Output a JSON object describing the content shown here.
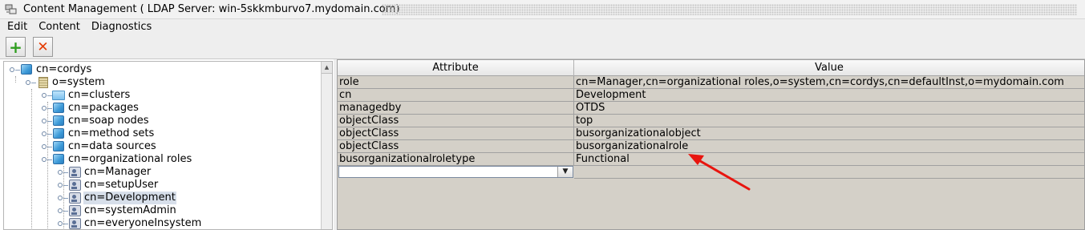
{
  "window": {
    "title": "Content Management ( LDAP Server: win-5skkmburvo7.mydomain.com)"
  },
  "menu": {
    "items": [
      {
        "label": "Edit"
      },
      {
        "label": "Content"
      },
      {
        "label": "Diagnostics"
      }
    ]
  },
  "toolbar": {
    "add_label": "+",
    "delete_label": "✕"
  },
  "tree": {
    "nodes": [
      {
        "label": "cn=cordys",
        "icon": "cube-icon",
        "level": 0
      },
      {
        "label": "o=system",
        "icon": "building-icon",
        "level": 1
      },
      {
        "label": "cn=clusters",
        "icon": "folder-icon",
        "level": 2
      },
      {
        "label": "cn=packages",
        "icon": "cube-icon",
        "level": 2
      },
      {
        "label": "cn=soap nodes",
        "icon": "cube-icon",
        "level": 2
      },
      {
        "label": "cn=method sets",
        "icon": "cube-icon",
        "level": 2
      },
      {
        "label": "cn=data sources",
        "icon": "cube-icon",
        "level": 2
      },
      {
        "label": "cn=organizational roles",
        "icon": "cube-icon",
        "level": 2
      },
      {
        "label": "cn=Manager",
        "icon": "role-icon",
        "level": 3
      },
      {
        "label": "cn=setupUser",
        "icon": "role-icon",
        "level": 3
      },
      {
        "label": "cn=Development",
        "icon": "role-icon",
        "level": 3,
        "selected": true
      },
      {
        "label": "cn=systemAdmin",
        "icon": "role-icon",
        "level": 3
      },
      {
        "label": "cn=everyoneInsystem",
        "icon": "role-icon",
        "level": 3
      }
    ]
  },
  "table": {
    "columns": [
      "Attribute",
      "Value"
    ],
    "rows": [
      {
        "attribute": "role",
        "value": "cn=Manager,cn=organizational roles,o=system,cn=cordys,cn=defaultInst,o=mydomain.com"
      },
      {
        "attribute": "cn",
        "value": "Development"
      },
      {
        "attribute": "managedby",
        "value": "OTDS"
      },
      {
        "attribute": "objectClass",
        "value": "top"
      },
      {
        "attribute": "objectClass",
        "value": "busorganizationalobject"
      },
      {
        "attribute": "objectClass",
        "value": "busorganizationalrole"
      },
      {
        "attribute": "busorganizationalroletype",
        "value": "Functional"
      }
    ],
    "new_attribute_value": ""
  },
  "annotation": {
    "color": "#e8150f"
  }
}
